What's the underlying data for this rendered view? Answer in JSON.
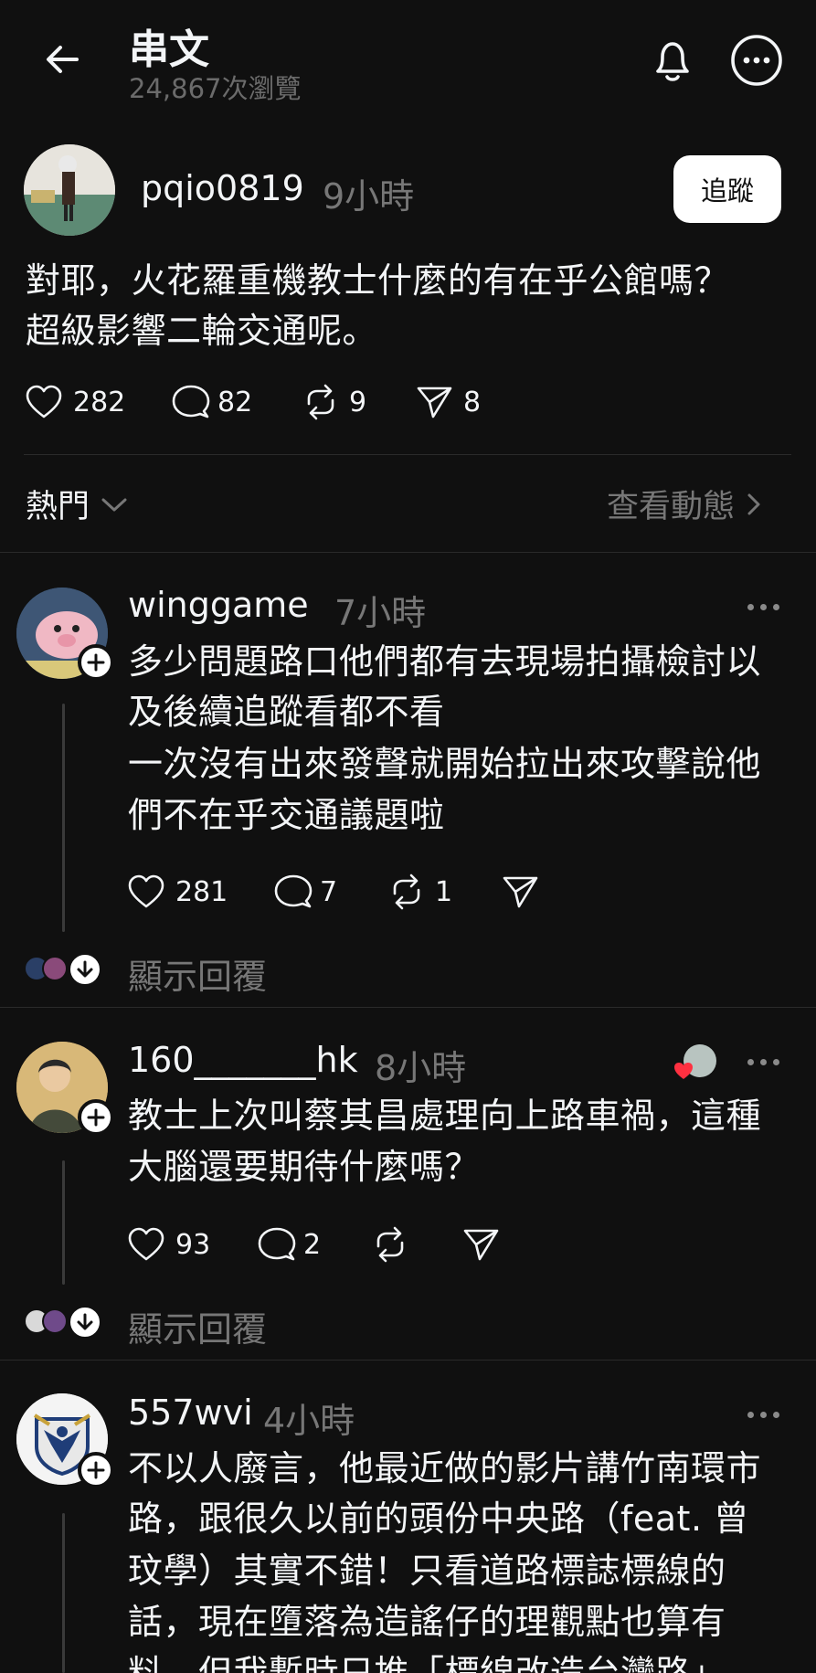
{
  "header": {
    "title": "串文",
    "views": "24,867次瀏覽"
  },
  "post": {
    "username": "pqio0819",
    "time": "9小時",
    "follow_label": "追蹤",
    "text_line1": "對耶，火花羅重機教士什麼的有在乎公館嗎？",
    "text_line2": "超級影響二輪交通呢。",
    "likes": "282",
    "comments": "82",
    "reposts": "9",
    "shares": "8"
  },
  "sort": {
    "label": "熱門",
    "activity": "查看動態"
  },
  "replies": [
    {
      "username": "winggame",
      "time": "7小時",
      "lines": [
        "多少問題路口他們都有去現場拍攝檢討以",
        "及後續追蹤看都不看",
        "一次沒有出來發聲就開始拉出來攻擊說他",
        "們不在乎交通議題啦"
      ],
      "likes": "281",
      "comments": "7",
      "reposts": "1",
      "show_replies": "顯示回覆"
    },
    {
      "username": "160_______hk",
      "time": "8小時",
      "lines": [
        "教士上次叫蔡其昌處理向上路車禍，這種",
        "大腦還要期待什麼嗎？"
      ],
      "likes": "93",
      "comments": "2",
      "show_replies": "顯示回覆"
    },
    {
      "username": "557wvi",
      "time": "4小時",
      "lines": [
        "不以人廢言，他最近做的影片講竹南環市",
        "路，跟很久以前的頭份中央路（feat. 曾",
        "玟學）其實不錯！只看道路標誌標線的",
        "話，現在墮落為造謠仔的理觀點也算有",
        "料，但我暫時只推「標線改造台灣路」，"
      ]
    }
  ],
  "colors": {
    "background": "#101010",
    "text": "#f3f5f7",
    "muted": "#777777",
    "like_heart": "#ff3040"
  }
}
